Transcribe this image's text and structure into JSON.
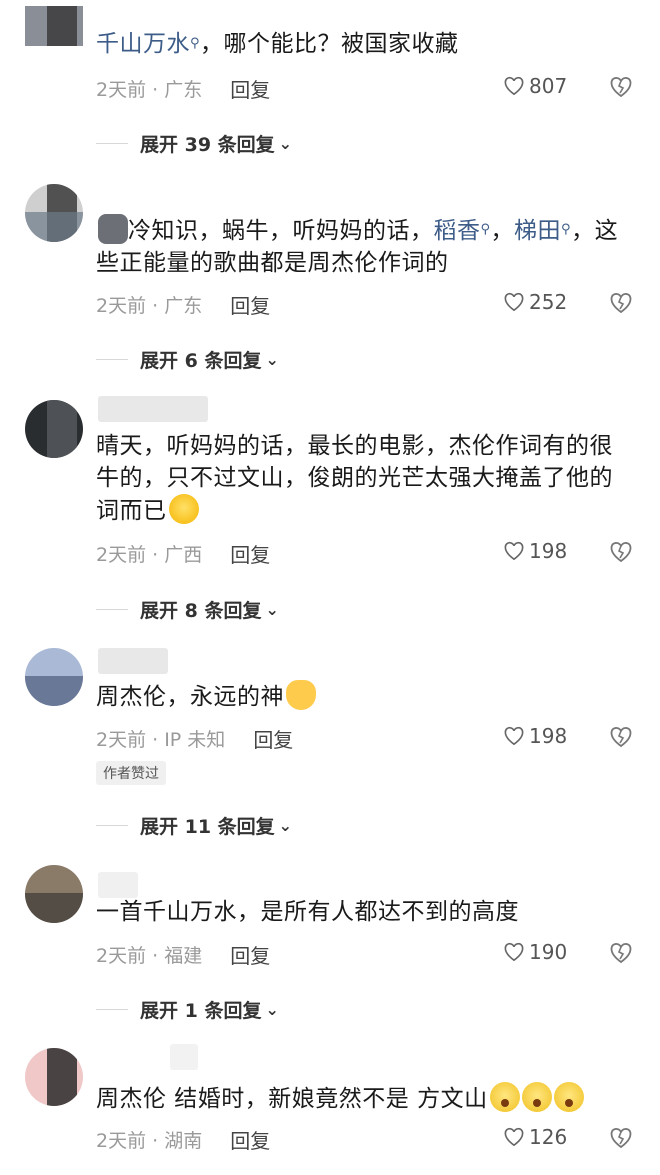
{
  "comments": [
    {
      "text_parts": [
        {
          "t": "千山万水",
          "link": true
        },
        {
          "t": "，哪个能比？被国家收藏",
          "link": false
        }
      ],
      "time": "2天前 · 广东",
      "reply": "回复",
      "likes": "807",
      "expand": "展开 39 条回复"
    },
    {
      "text_parts": [
        {
          "t": "冷知识，蜗牛，听妈妈的话，",
          "link": false
        },
        {
          "t": "稻香",
          "link": true
        },
        {
          "t": "，",
          "link": false
        },
        {
          "t": "梯田",
          "link": true
        },
        {
          "t": "，这些正能量的歌曲都是周杰伦作词的",
          "link": false
        }
      ],
      "time": "2天前 · 广东",
      "reply": "回复",
      "likes": "252",
      "expand": "展开 6 条回复"
    },
    {
      "text_parts": [
        {
          "t": "晴天，听妈妈的话，最长的电影，杰伦作词有的很牛的，只不过文山，俊朗的光芒太强大掩盖了他的词而已",
          "link": false
        }
      ],
      "time": "2天前 · 广西",
      "reply": "回复",
      "likes": "198",
      "expand": "展开 8 条回复"
    },
    {
      "text_parts": [
        {
          "t": "周杰伦，永远的神",
          "link": false
        }
      ],
      "time": "2天前 · IP 未知",
      "reply": "回复",
      "likes": "198",
      "badge": "作者赞过",
      "expand": "展开 11 条回复"
    },
    {
      "text_parts": [
        {
          "t": "一首千山万水，是所有人都达不到的高度",
          "link": false
        }
      ],
      "time": "2天前 · 福建",
      "reply": "回复",
      "likes": "190",
      "expand": "展开 1 条回复"
    },
    {
      "text_parts": [
        {
          "t": "周杰伦 结婚时，新娘竟然不是 方文山",
          "link": false
        }
      ],
      "time": "2天前 · 湖南",
      "reply": "回复",
      "likes": "126"
    }
  ],
  "icons": {
    "heart": "heart-outline-icon",
    "dislike": "broken-heart-icon",
    "search_superscript": "search-icon",
    "chevron": "chevron-down-icon"
  },
  "colors": {
    "link": "#3d5c88",
    "meta": "#9a9a9a",
    "text": "#1a1a1a"
  }
}
